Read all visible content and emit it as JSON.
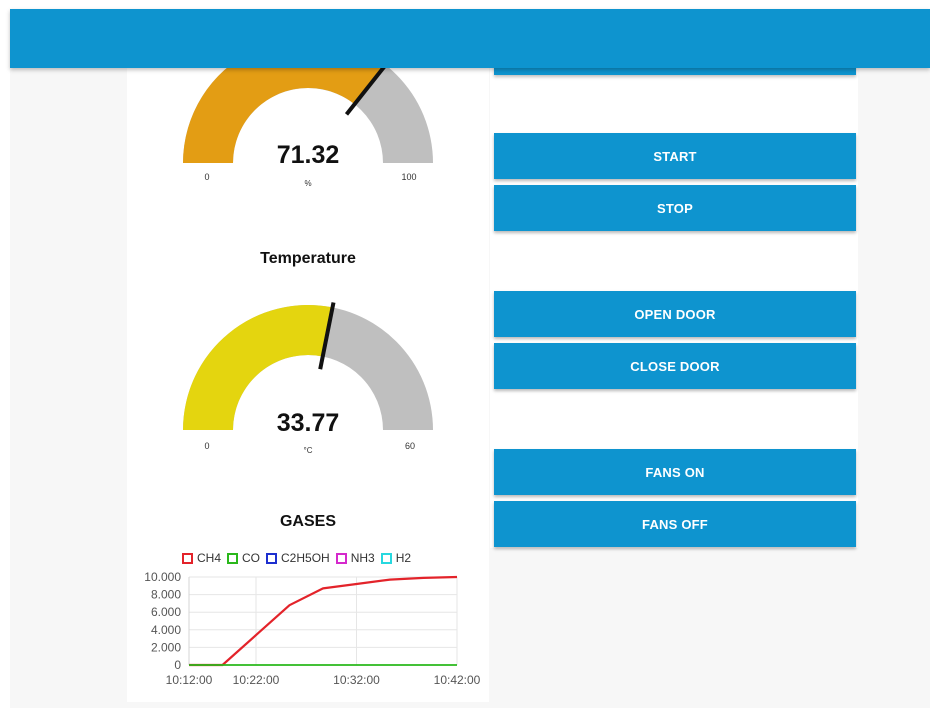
{
  "gauges": {
    "humidity": {
      "value_text": "71.32",
      "value": 71.32,
      "min": 0,
      "max": 100,
      "min_label": "0",
      "max_label": "100",
      "unit": "%",
      "color": "#e39d14"
    },
    "temperature": {
      "title": "Temperature",
      "value_text": "33.77",
      "value": 33.77,
      "min": 0,
      "max": 60,
      "min_label": "0",
      "max_label": "60",
      "unit": "°C",
      "color": "#e4d50f"
    }
  },
  "controls": {
    "start_label": "START",
    "stop_label": "STOP",
    "open_door_label": "OPEN DOOR",
    "close_door_label": "CLOSE DOOR",
    "fans_on_label": "FANS ON",
    "fans_off_label": "FANS OFF"
  },
  "colors": {
    "header": "#0e94cf",
    "button": "#0e94cf",
    "gauge_track": "#bfbfbf"
  },
  "chart_data": {
    "type": "line",
    "title": "GASES",
    "x": [
      "10:12:00",
      "10:17:00",
      "10:22:00",
      "10:27:00",
      "10:30:00",
      "10:32:00",
      "10:34:00",
      "10:37:00",
      "10:42:00"
    ],
    "tick_labels_x": [
      "10:12:00",
      "10:22:00",
      "10:32:00",
      "10:42:00"
    ],
    "tick_labels_y": [
      "0",
      "2.000",
      "4.000",
      "6.000",
      "8.000",
      "10.000"
    ],
    "ylim": [
      0,
      10000
    ],
    "grid": true,
    "legend": "top",
    "series": [
      {
        "name": "CH4",
        "color": "#e3232a",
        "values": [
          0,
          0,
          3400,
          6800,
          8700,
          9200,
          9700,
          9900,
          10000
        ]
      },
      {
        "name": "CO",
        "color": "#2ab81b",
        "values": [
          0,
          0,
          0,
          0,
          0,
          0,
          0,
          0,
          0
        ]
      },
      {
        "name": "C2H5OH",
        "color": "#1d2fcf",
        "values": []
      },
      {
        "name": "NH3",
        "color": "#d529cc",
        "values": []
      },
      {
        "name": "H2",
        "color": "#27d8df",
        "values": []
      }
    ]
  }
}
